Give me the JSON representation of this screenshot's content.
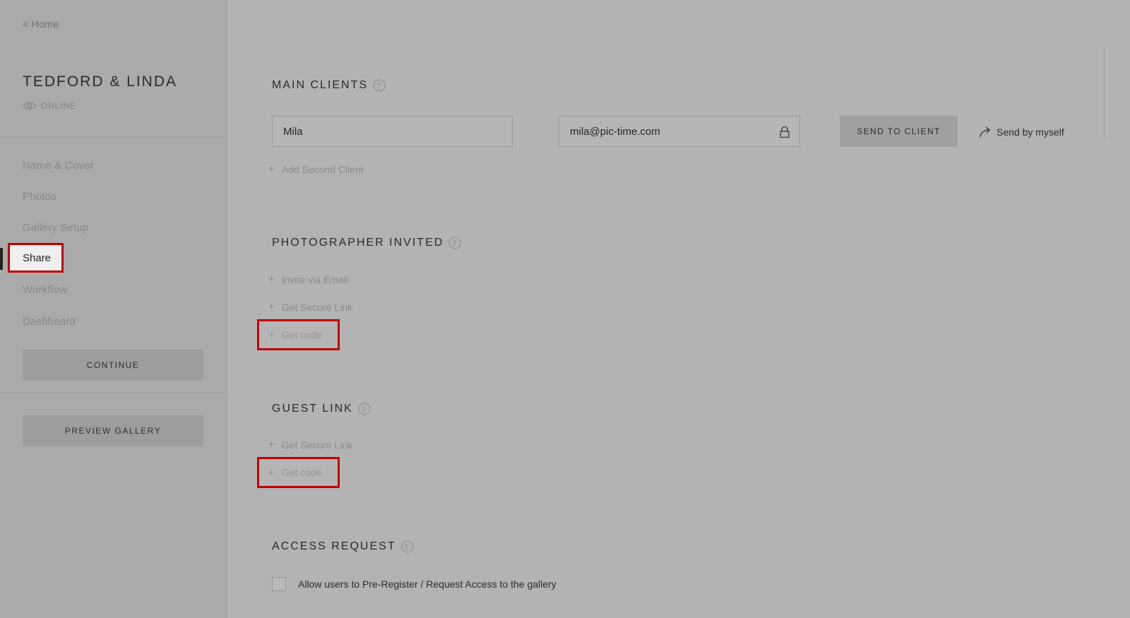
{
  "sidebar": {
    "home_link": "< Home",
    "gallery_title": "TEDFORD & LINDA",
    "status": "ONLINE",
    "items": [
      {
        "label": "Name & Cover"
      },
      {
        "label": "Photos"
      },
      {
        "label": "Gallery Setup"
      },
      {
        "label": "Share"
      },
      {
        "label": "Workflow"
      },
      {
        "label": "Dashboard"
      }
    ],
    "continue_label": "CONTINUE",
    "preview_label": "PREVIEW GALLERY"
  },
  "main_clients": {
    "title": "MAIN CLIENTS",
    "name_value": "Mila",
    "email_value": "mila@pic-time.com",
    "send_button": "SEND TO CLIENT",
    "send_self": "Send by myself",
    "add_second": "Add Second Client"
  },
  "photographer_invited": {
    "title": "PHOTOGRAPHER INVITED",
    "invite_email": "Invite via Email",
    "secure_link": "Get Secure Link",
    "get_code": "Get code"
  },
  "guest_link": {
    "title": "GUEST LINK",
    "secure_link": "Get Secure Link",
    "get_code": "Get code"
  },
  "access_request": {
    "title": "ACCESS REQUEST",
    "checkbox_label": "Allow users to Pre-Register / Request Access to the gallery"
  },
  "colors": {
    "highlight": "#c00000",
    "background": "#b3b3b3"
  }
}
